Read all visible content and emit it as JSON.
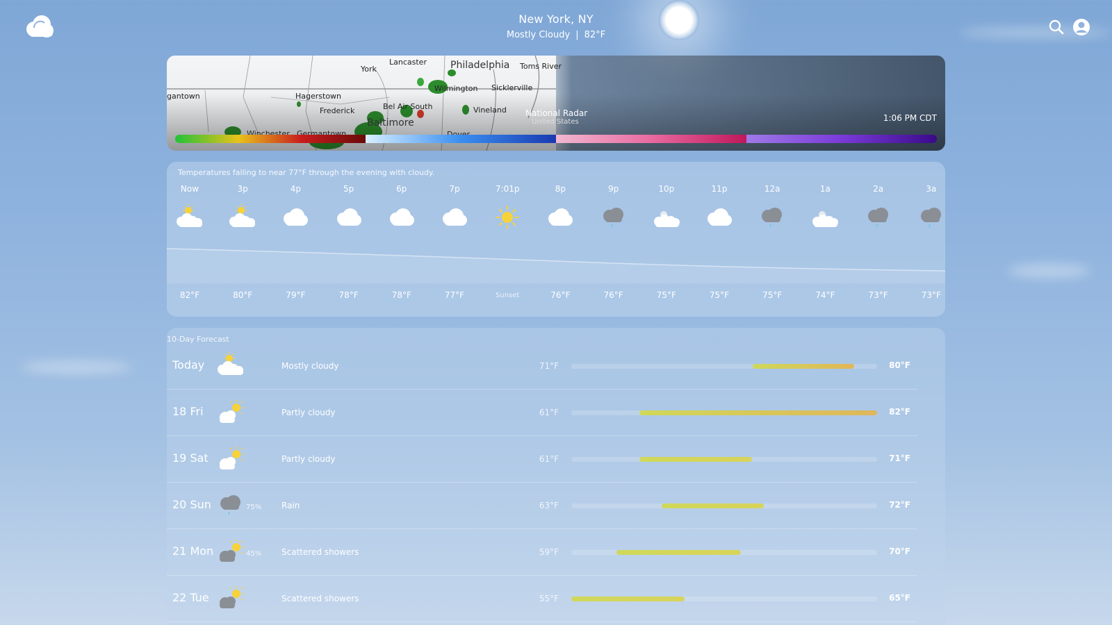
{
  "header": {
    "city": "New York, NY",
    "condition": "Mostly Cloudy",
    "separator": "|",
    "current_temp": "82°F",
    "icons": [
      "logo-cloud-icon",
      "search-icon",
      "account-icon"
    ]
  },
  "radar": {
    "title": "National Radar",
    "subtitle": "United States",
    "time": "1:06 PM CDT",
    "labels": [
      "York",
      "Lancaster",
      "Philadelphia",
      "Toms River",
      "Wilmington",
      "Sicklerville",
      "Hagerstown",
      "gantown",
      "Frederick",
      "Bel Air South",
      "Vineland",
      "Baltimore",
      "Winchester",
      "Germantown",
      "Dover"
    ],
    "legend_colors": [
      "#22c23a",
      "#e9c21a",
      "#c81c1c",
      "#3a8ef0",
      "#e86aa0",
      "#7a3ad8"
    ]
  },
  "hourly": {
    "summary": "Temperatures falling to near 77°F through the evening with cloudy.",
    "hours": [
      {
        "label": "Now",
        "icon": "partly-sunny-clouds-icon",
        "temp": "82°F"
      },
      {
        "label": "3p",
        "icon": "partly-sunny-clouds-icon",
        "temp": "80°F"
      },
      {
        "label": "4p",
        "icon": "cloud-icon",
        "temp": "79°F"
      },
      {
        "label": "5p",
        "icon": "cloud-icon",
        "temp": "78°F"
      },
      {
        "label": "6p",
        "icon": "cloud-icon",
        "temp": "78°F"
      },
      {
        "label": "7p",
        "icon": "cloud-icon",
        "temp": "77°F"
      },
      {
        "label": "7:01p",
        "icon": "sun-icon",
        "temp": "Sunset"
      },
      {
        "label": "8p",
        "icon": "cloud-icon",
        "temp": "76°F"
      },
      {
        "label": "9p",
        "icon": "rain-cloud-icon",
        "temp": "76°F"
      },
      {
        "label": "10p",
        "icon": "night-clouds-icon",
        "temp": "75°F"
      },
      {
        "label": "11p",
        "icon": "cloud-icon",
        "temp": "75°F"
      },
      {
        "label": "12a",
        "icon": "rain-cloud-icon",
        "temp": "75°F"
      },
      {
        "label": "1a",
        "icon": "night-clouds-icon",
        "temp": "74°F"
      },
      {
        "label": "2a",
        "icon": "rain-cloud-icon",
        "temp": "73°F"
      },
      {
        "label": "3a",
        "icon": "rain-cloud-icon",
        "temp": "73°F"
      }
    ]
  },
  "tenday": {
    "title": "10-Day Forecast",
    "scale_min": 55,
    "scale_max": 82,
    "days": [
      {
        "name": "Today",
        "icon": "partly-sunny-clouds-icon",
        "pct": "",
        "cond": "Mostly cloudy",
        "low": "71°F",
        "high": "80°F",
        "low_v": 71,
        "high_v": 80
      },
      {
        "name": "18 Fri",
        "icon": "partly-cloudy-icon",
        "pct": "",
        "cond": "Partly cloudy",
        "low": "61°F",
        "high": "82°F",
        "low_v": 61,
        "high_v": 82
      },
      {
        "name": "19 Sat",
        "icon": "partly-cloudy-icon",
        "pct": "",
        "cond": "Partly cloudy",
        "low": "61°F",
        "high": "71°F",
        "low_v": 61,
        "high_v": 71
      },
      {
        "name": "20 Sun",
        "icon": "rain-cloud-icon",
        "pct": "75%",
        "cond": "Rain",
        "low": "63°F",
        "high": "72°F",
        "low_v": 63,
        "high_v": 72
      },
      {
        "name": "21 Mon",
        "icon": "sun-shower-icon",
        "pct": "45%",
        "cond": "Scattered showers",
        "low": "59°F",
        "high": "70°F",
        "low_v": 59,
        "high_v": 70
      },
      {
        "name": "22 Tue",
        "icon": "sun-shower-icon",
        "pct": "",
        "cond": "Scattered showers",
        "low": "55°F",
        "high": "65°F",
        "low_v": 55,
        "high_v": 65
      }
    ]
  }
}
